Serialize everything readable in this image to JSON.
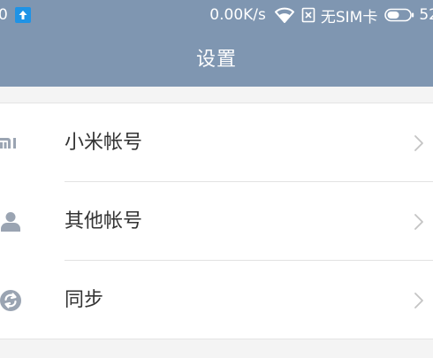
{
  "status_bar": {
    "notification_count": "0",
    "upload_icon": "upload-arrow-icon",
    "net_speed": "0.00K/s",
    "wifi_icon": "wifi-icon",
    "sim_icon": "no-sim-icon",
    "sim_text": "无SIM卡",
    "battery_icon": "battery-icon",
    "battery_level": "52"
  },
  "header": {
    "title": "设置",
    "background_color": "#7f96b1"
  },
  "settings": {
    "items": [
      {
        "label": "小米帐号",
        "icon": "mi-logo-icon"
      },
      {
        "label": "其他帐号",
        "icon": "person-icon"
      },
      {
        "label": "同步",
        "icon": "sync-icon"
      }
    ]
  },
  "colors": {
    "icon": "#9aa4b2",
    "text": "#333333",
    "chevron": "#c4c4c4"
  }
}
